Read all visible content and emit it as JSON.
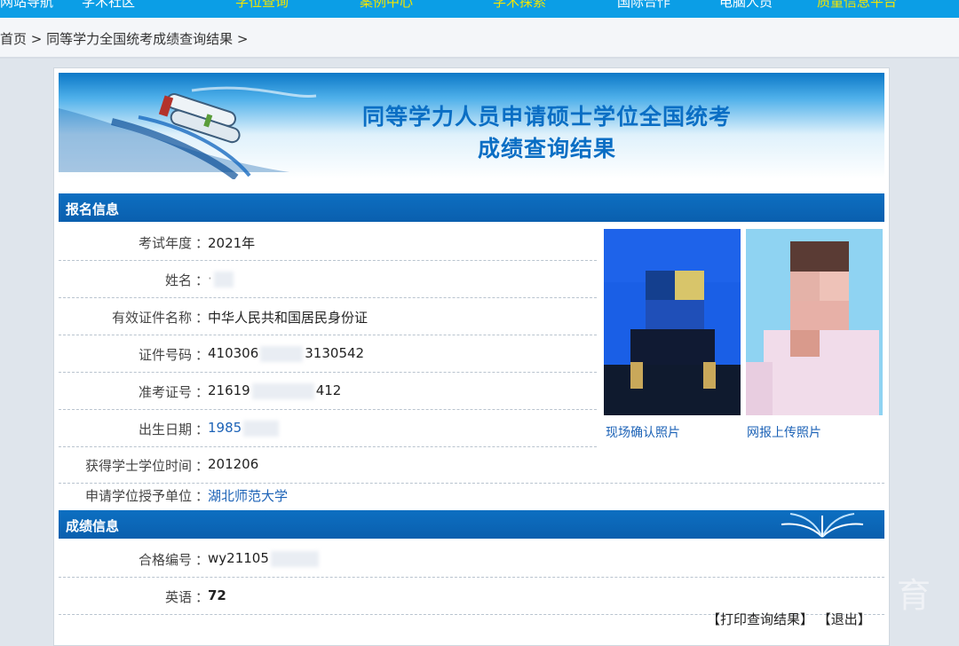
{
  "topnav": {
    "items": [
      "网站导航",
      "学术社区",
      "学位查询",
      "案例中心",
      "学术探索",
      "国际合作",
      "电脑人员",
      "质量信息平台"
    ]
  },
  "breadcrumb": "首页 > 同等学力全国统考成绩查询结果 >",
  "banner": {
    "title_line1": "同等学力人员申请硕士学位全国统考",
    "title_line2": "成绩查询结果"
  },
  "registration": {
    "header": "报名信息",
    "colon": "：",
    "fields": [
      {
        "label": "考试年度",
        "value": "2021年"
      },
      {
        "label": "姓名",
        "value": "·"
      },
      {
        "label": "有效证件名称",
        "value": "中华人民共和国居民身份证"
      },
      {
        "label": "证件号码",
        "value_a": "410306",
        "value_b": "3130542"
      },
      {
        "label": "准考证号",
        "value_a": "21619",
        "value_b": "412"
      },
      {
        "label": "出生日期",
        "value": "1985"
      },
      {
        "label": "获得学士学位时间",
        "value": "201206"
      },
      {
        "label": "申请学位授予单位",
        "value": "湖北师范大学"
      }
    ],
    "photo_onsite_caption": "现场确认照片",
    "photo_upload_caption": "网报上传照片"
  },
  "scores": {
    "header": "成绩信息",
    "fields": [
      {
        "label": "合格编号",
        "value": "wy21105"
      },
      {
        "label": "英语",
        "value": "72"
      }
    ]
  },
  "actions": {
    "print": "【打印查询结果】",
    "exit": "【退出】"
  },
  "watermark": "育",
  "colors": {
    "nav_bg": "#0b9ee6",
    "section_header": "#0a5fae",
    "link": "#1d63b7",
    "title": "#0a6ec4"
  }
}
